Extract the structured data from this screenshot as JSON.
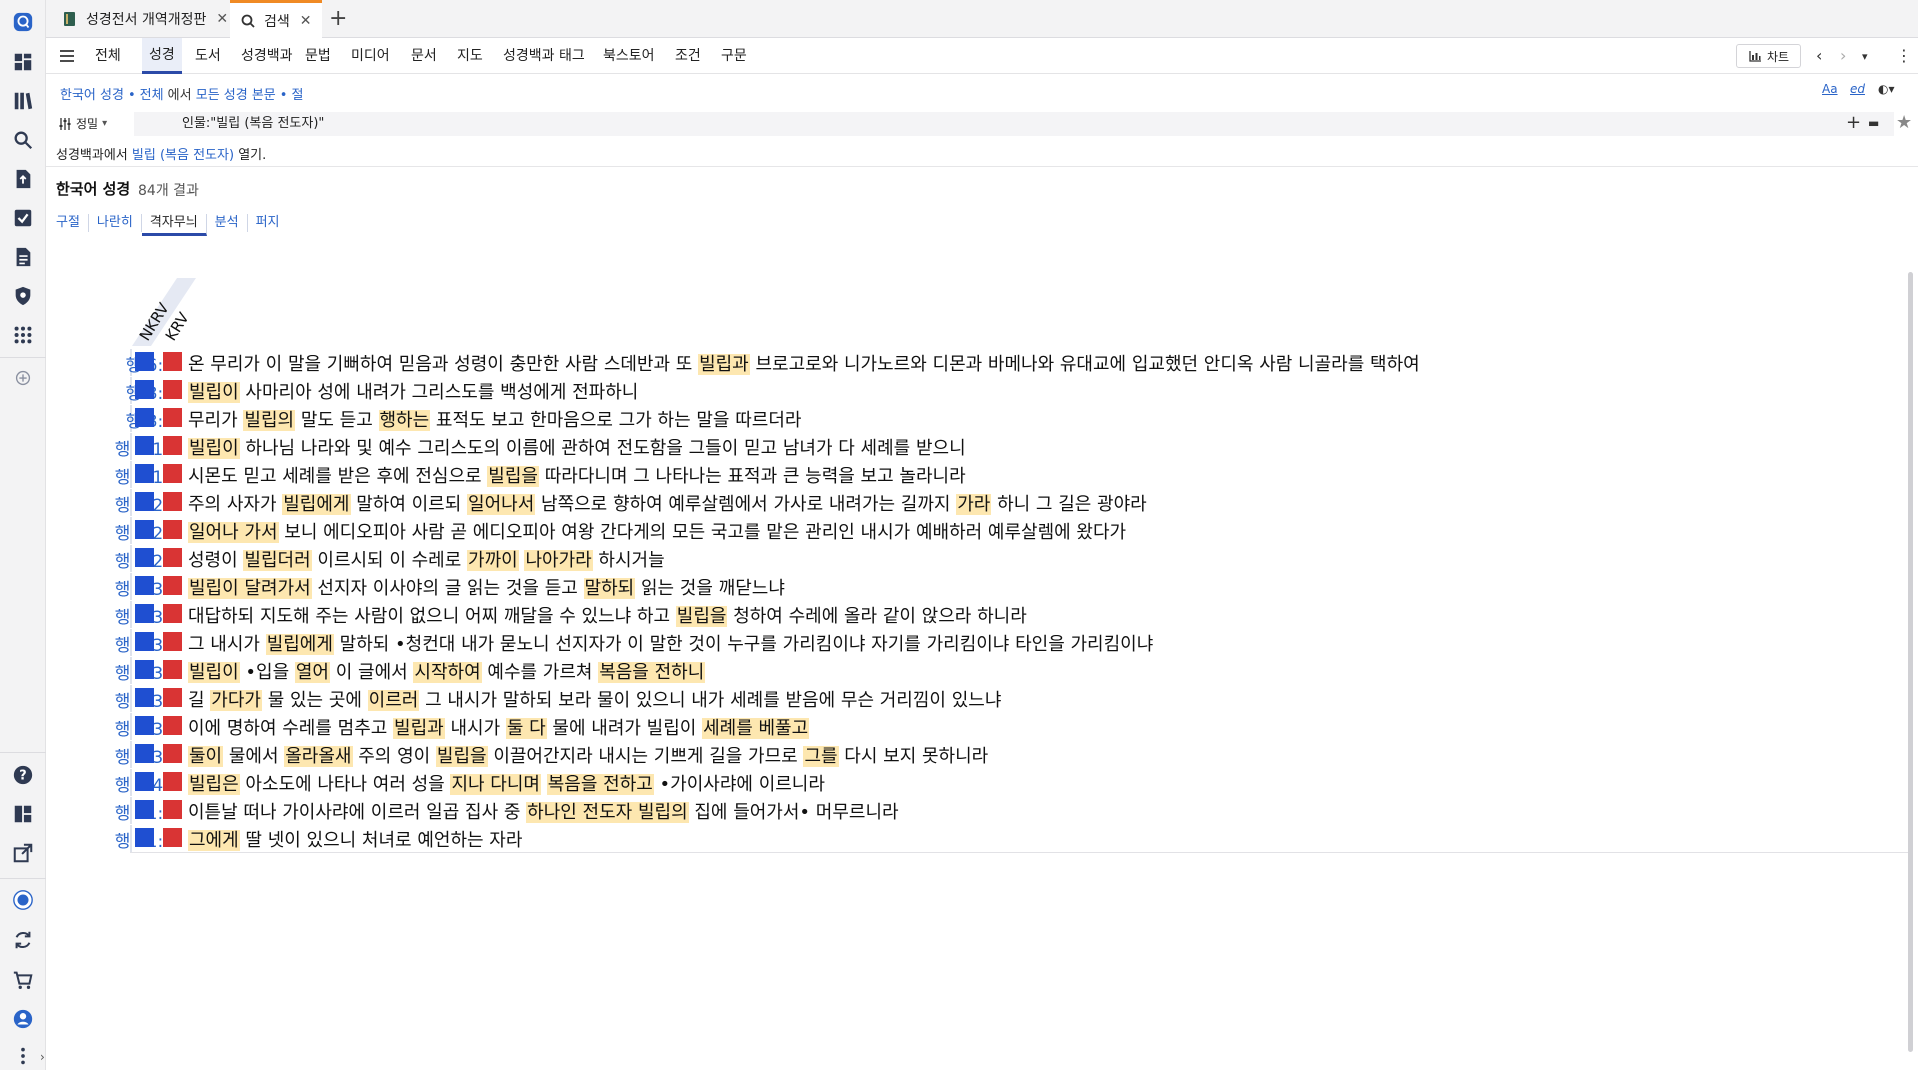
{
  "tabs": [
    {
      "label": "성경전서 개역개정판",
      "close": "✕"
    },
    {
      "label": "검색",
      "close": "✕"
    }
  ],
  "add_tab": "+",
  "nav": {
    "items": [
      "전체",
      "성경",
      "도서",
      "성경백과",
      "문법",
      "미디어",
      "문서",
      "지도",
      "성경백과 태그",
      "북스토어",
      "조건",
      "구문"
    ],
    "active": "성경",
    "chart_label": "차트"
  },
  "breadcrumb": {
    "part1": "한국어 성경",
    "part2": "전체",
    "mid": "에서",
    "part3": "모든 성경 본문",
    "part4": "절"
  },
  "top_right": {
    "aa": "Aa",
    "ed": "ed"
  },
  "query": {
    "mode": "정밀",
    "value": "인물:\"빌립 (복음 전도자)\""
  },
  "open_line": {
    "prefix": "성경백과에서",
    "link": "빌립 (복음 전도자)",
    "suffix": "열기."
  },
  "results": {
    "title": "한국어 성경",
    "count": "84개 결과"
  },
  "view_tabs": [
    {
      "label": "구절",
      "active": false
    },
    {
      "label": "나란히",
      "active": false
    },
    {
      "label": "격자무늬",
      "active": true
    },
    {
      "label": "분석",
      "active": false
    },
    {
      "label": "퍼지",
      "active": false
    }
  ],
  "columns": [
    "NKRV",
    "KRV"
  ],
  "colors": {
    "nkrv": "#1f4fd1",
    "krv": "#d93434",
    "highlight": "#fde7b0",
    "link": "#2a64c8"
  },
  "rows": [
    {
      "ref": "행 6:5",
      "segs": [
        [
          "온 무리가 이 말을 기뻐하여 믿음과 성령이 충만한 사람 스데반과 또 ",
          0
        ],
        [
          "빌립과",
          1
        ],
        [
          " 브로고로와 니가노르와 디몬과 바메나와 유대교에 입교했던 안디옥 사람 니골라를 택하여",
          0
        ]
      ]
    },
    {
      "ref": "행 8:5",
      "segs": [
        [
          "빌립이",
          1
        ],
        [
          " 사마리아 성에 내려가 그리스도를 백성에게 전파하니",
          0
        ]
      ]
    },
    {
      "ref": "행 8:6",
      "segs": [
        [
          "무리가 ",
          0
        ],
        [
          "빌립의",
          1
        ],
        [
          " 말도 듣고 ",
          0
        ],
        [
          "행하는",
          1
        ],
        [
          " 표적도 보고 한마음으로 그가 하는 말을 따르더라",
          0
        ]
      ]
    },
    {
      "ref": "행 8:12",
      "segs": [
        [
          "빌립이",
          1
        ],
        [
          " 하나님 나라와 및 예수 그리스도의 이름에 관하여 전도함을 그들이 믿고 남녀가 다 세례를 받으니",
          0
        ]
      ]
    },
    {
      "ref": "행 8:13",
      "segs": [
        [
          "시몬도 믿고 세례를 받은 후에 전심으로 ",
          0
        ],
        [
          "빌립을",
          1
        ],
        [
          " 따라다니며 그 나타나는 표적과 큰 능력을 보고 놀라니라",
          0
        ]
      ]
    },
    {
      "ref": "행 8:26",
      "segs": [
        [
          "주의 사자가 ",
          0
        ],
        [
          "빌립에게",
          1
        ],
        [
          " 말하여 이르되 ",
          0
        ],
        [
          "일어나서",
          1
        ],
        [
          " 남쪽으로 향하여 예루살렘에서 가사로 내려가는 길까지 ",
          0
        ],
        [
          "가라",
          1
        ],
        [
          " 하니 그 길은 광야라",
          0
        ]
      ]
    },
    {
      "ref": "행 8:27",
      "segs": [
        [
          "일어나 가서",
          1
        ],
        [
          " 보니 에디오피아 사람 곧 에디오피아 여왕 간다게의 모든 국고를 맡은 관리인 내시가 예배하러 예루살렘에 왔다가",
          0
        ]
      ]
    },
    {
      "ref": "행 8:29",
      "segs": [
        [
          "성령이 ",
          0
        ],
        [
          "빌립더러",
          1
        ],
        [
          " 이르시되 이 수레로 ",
          0
        ],
        [
          "가까이",
          1
        ],
        [
          " ",
          0
        ],
        [
          "나아가라",
          1
        ],
        [
          " 하시거늘",
          0
        ]
      ]
    },
    {
      "ref": "행 8:30",
      "segs": [
        [
          "빌립이 달려가서",
          1
        ],
        [
          " 선지자 이사야의 글 읽는 것을 듣고 ",
          0
        ],
        [
          "말하되",
          1
        ],
        [
          " 읽는 것을 깨닫느냐",
          0
        ]
      ]
    },
    {
      "ref": "행 8:31",
      "segs": [
        [
          "대답하되 지도해 주는 사람이 없으니 어찌 깨달을 수 있느냐 하고 ",
          0
        ],
        [
          "빌립을",
          1
        ],
        [
          " 청하여 수레에 올라 같이 앉으라 하니라",
          0
        ]
      ]
    },
    {
      "ref": "행 8:34",
      "segs": [
        [
          "그 내시가 ",
          0
        ],
        [
          "빌립에게",
          1
        ],
        [
          " 말하되 •청컨대 내가 묻노니 선지자가 이 말한 것이 누구를 가리킴이냐 자기를 가리킴이냐 타인을 가리킴이냐",
          0
        ]
      ]
    },
    {
      "ref": "행 8:35",
      "segs": [
        [
          "빌립이",
          1
        ],
        [
          " •입을 ",
          0
        ],
        [
          "열어",
          1
        ],
        [
          " 이 글에서 ",
          0
        ],
        [
          "시작하여",
          1
        ],
        [
          " 예수를 가르쳐 ",
          0
        ],
        [
          "복음을 전하니",
          1
        ]
      ]
    },
    {
      "ref": "행 8:36",
      "segs": [
        [
          "길 ",
          0
        ],
        [
          "가다가",
          1
        ],
        [
          " 물 있는 곳에 ",
          0
        ],
        [
          "이르러",
          1
        ],
        [
          " 그 내시가 말하되 보라 물이 있으니 내가 세례를 받음에 무슨 거리낌이 있느냐",
          0
        ]
      ]
    },
    {
      "ref": "행 8:38",
      "segs": [
        [
          "이에 명하여 수레를 멈추고 ",
          0
        ],
        [
          "빌립과",
          1
        ],
        [
          " 내시가 ",
          0
        ],
        [
          "둘 다",
          1
        ],
        [
          " 물에 내려가 빌립이 ",
          0
        ],
        [
          "세례를 베풀고",
          1
        ]
      ]
    },
    {
      "ref": "행 8:39",
      "segs": [
        [
          "둘이",
          1
        ],
        [
          " 물에서 ",
          0
        ],
        [
          "올라올새",
          1
        ],
        [
          " 주의 영이 ",
          0
        ],
        [
          "빌립을",
          1
        ],
        [
          " 이끌어간지라 내시는 기쁘게 길을 가므로 ",
          0
        ],
        [
          "그를",
          1
        ],
        [
          " 다시 보지 못하니라",
          0
        ]
      ]
    },
    {
      "ref": "행 8:40",
      "segs": [
        [
          "빌립은",
          1
        ],
        [
          " 아소도에 나타나 여러 성을 ",
          0
        ],
        [
          "지나 다니며",
          1
        ],
        [
          " ",
          0
        ],
        [
          "복음을 전하고",
          1
        ],
        [
          " •가이사랴에 이르니라",
          0
        ]
      ]
    },
    {
      "ref": "행 21:8",
      "segs": [
        [
          "이튿날 떠나 가이사랴에 이르러 일곱 집사 중 ",
          0
        ],
        [
          "하나인 전도자 빌립의",
          1
        ],
        [
          " 집에 들어가서• 머무르니라",
          0
        ]
      ]
    },
    {
      "ref": "행 21:9",
      "segs": [
        [
          "그에게",
          1
        ],
        [
          " 딸 넷이 있으니 처녀로 예언하는 자라",
          0
        ]
      ]
    }
  ]
}
